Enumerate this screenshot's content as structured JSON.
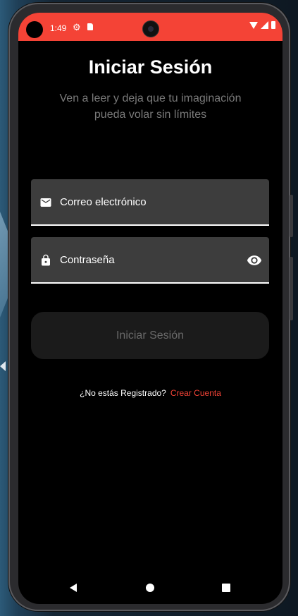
{
  "status_bar": {
    "time": "1:49",
    "icons": [
      "gear-icon",
      "sd-card-icon",
      "wifi-icon",
      "signal-icon",
      "battery-icon"
    ],
    "color": "#f44336"
  },
  "login": {
    "title": "Iniciar Sesión",
    "subtitle": "Ven a leer y deja que tu imaginación pueda volar sin límites",
    "email_label": "Correo electrónico",
    "password_label": "Contraseña",
    "submit_label": "Iniciar Sesión",
    "register_prompt": "¿No estás Registrado?",
    "register_link": "Crear Cuenta"
  },
  "nav_bar": {
    "icons": [
      "back-icon",
      "home-icon",
      "recents-icon"
    ]
  },
  "colors": {
    "accent": "#f44336",
    "field_bg": "#3d3d3d",
    "screen_bg": "#000000"
  }
}
